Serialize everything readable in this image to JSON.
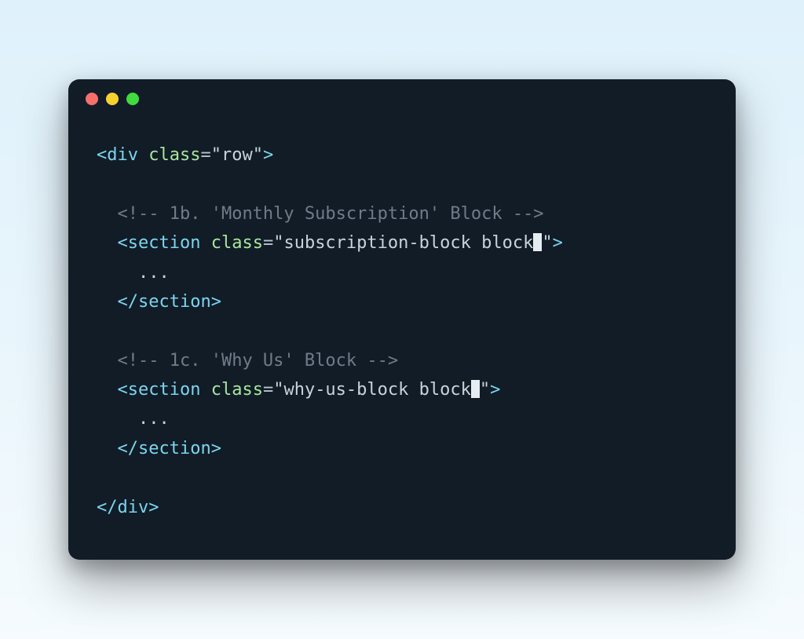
{
  "window": {
    "traffic_lights": [
      "red",
      "yellow",
      "green"
    ]
  },
  "code": {
    "line1": {
      "open": "<",
      "tag": "div",
      "space": " ",
      "attr": "class",
      "eq": "=",
      "q1": "\"",
      "value": "row",
      "q2": "\"",
      "close": ">"
    },
    "comment1": "<!-- 1b. 'Monthly Subscription' Block -->",
    "section1": {
      "open": "<",
      "tag": "section",
      "space": " ",
      "attr": "class",
      "eq": "=",
      "q1": "\"",
      "value": "subscription-block block",
      "q2": "\"",
      "close": ">"
    },
    "section1_body": "...",
    "section1_close": {
      "open": "</",
      "tag": "section",
      "close": ">"
    },
    "comment2": "<!-- 1c. 'Why Us' Block -->",
    "section2": {
      "open": "<",
      "tag": "section",
      "space": " ",
      "attr": "class",
      "eq": "=",
      "q1": "\"",
      "value": "why-us-block block",
      "q2": "\"",
      "close": ">"
    },
    "section2_body": "...",
    "section2_close": {
      "open": "</",
      "tag": "section",
      "close": ">"
    },
    "div_close": {
      "open": "</",
      "tag": "div",
      "close": ">"
    }
  }
}
